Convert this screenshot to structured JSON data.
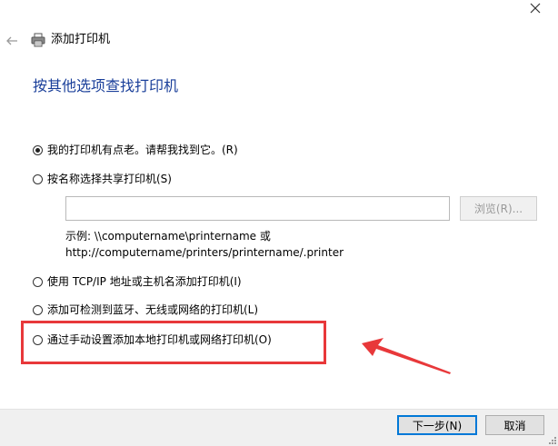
{
  "window": {
    "title": "添加打印机",
    "back_icon": "back-arrow-icon",
    "close_icon": "close-icon",
    "printer_icon": "printer-icon"
  },
  "heading": "按其他选项查找打印机",
  "options": [
    {
      "label": "我的打印机有点老。请帮我找到它。(R)",
      "selected": true
    },
    {
      "label": "按名称选择共享打印机(S)",
      "selected": false
    },
    {
      "label": "使用 TCP/IP 地址或主机名添加打印机(I)",
      "selected": false
    },
    {
      "label": "添加可检测到蓝牙、无线或网络的打印机(L)",
      "selected": false
    },
    {
      "label": "通过手动设置添加本地打印机或网络打印机(O)",
      "selected": false
    }
  ],
  "share": {
    "input_value": "",
    "browse_label": "浏览(R)...",
    "example_line1": "示例: \\\\computername\\printername 或",
    "example_line2": "http://computername/printers/printername/.printer"
  },
  "annotation": {
    "highlight_color": "#e8383a"
  },
  "buttons": {
    "next": "下一步(N)",
    "cancel": "取消"
  },
  "colors": {
    "heading": "#1a3f9a",
    "accent": "#0078d7"
  }
}
